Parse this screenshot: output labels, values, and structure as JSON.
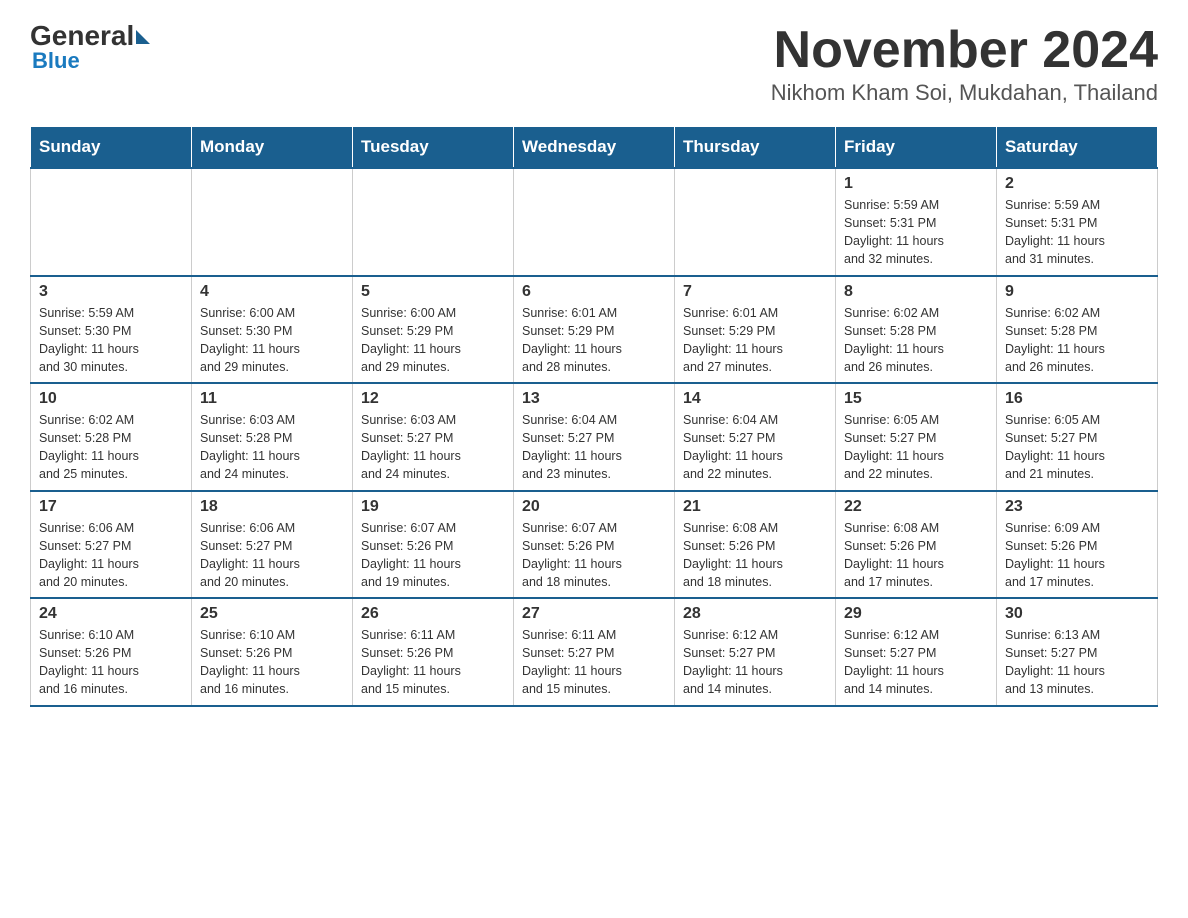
{
  "header": {
    "logo": {
      "general": "General",
      "blue": "Blue"
    },
    "title": "November 2024",
    "location": "Nikhom Kham Soi, Mukdahan, Thailand"
  },
  "calendar": {
    "days_of_week": [
      "Sunday",
      "Monday",
      "Tuesday",
      "Wednesday",
      "Thursday",
      "Friday",
      "Saturday"
    ],
    "weeks": [
      [
        {
          "day": "",
          "info": ""
        },
        {
          "day": "",
          "info": ""
        },
        {
          "day": "",
          "info": ""
        },
        {
          "day": "",
          "info": ""
        },
        {
          "day": "",
          "info": ""
        },
        {
          "day": "1",
          "info": "Sunrise: 5:59 AM\nSunset: 5:31 PM\nDaylight: 11 hours\nand 32 minutes."
        },
        {
          "day": "2",
          "info": "Sunrise: 5:59 AM\nSunset: 5:31 PM\nDaylight: 11 hours\nand 31 minutes."
        }
      ],
      [
        {
          "day": "3",
          "info": "Sunrise: 5:59 AM\nSunset: 5:30 PM\nDaylight: 11 hours\nand 30 minutes."
        },
        {
          "day": "4",
          "info": "Sunrise: 6:00 AM\nSunset: 5:30 PM\nDaylight: 11 hours\nand 29 minutes."
        },
        {
          "day": "5",
          "info": "Sunrise: 6:00 AM\nSunset: 5:29 PM\nDaylight: 11 hours\nand 29 minutes."
        },
        {
          "day": "6",
          "info": "Sunrise: 6:01 AM\nSunset: 5:29 PM\nDaylight: 11 hours\nand 28 minutes."
        },
        {
          "day": "7",
          "info": "Sunrise: 6:01 AM\nSunset: 5:29 PM\nDaylight: 11 hours\nand 27 minutes."
        },
        {
          "day": "8",
          "info": "Sunrise: 6:02 AM\nSunset: 5:28 PM\nDaylight: 11 hours\nand 26 minutes."
        },
        {
          "day": "9",
          "info": "Sunrise: 6:02 AM\nSunset: 5:28 PM\nDaylight: 11 hours\nand 26 minutes."
        }
      ],
      [
        {
          "day": "10",
          "info": "Sunrise: 6:02 AM\nSunset: 5:28 PM\nDaylight: 11 hours\nand 25 minutes."
        },
        {
          "day": "11",
          "info": "Sunrise: 6:03 AM\nSunset: 5:28 PM\nDaylight: 11 hours\nand 24 minutes."
        },
        {
          "day": "12",
          "info": "Sunrise: 6:03 AM\nSunset: 5:27 PM\nDaylight: 11 hours\nand 24 minutes."
        },
        {
          "day": "13",
          "info": "Sunrise: 6:04 AM\nSunset: 5:27 PM\nDaylight: 11 hours\nand 23 minutes."
        },
        {
          "day": "14",
          "info": "Sunrise: 6:04 AM\nSunset: 5:27 PM\nDaylight: 11 hours\nand 22 minutes."
        },
        {
          "day": "15",
          "info": "Sunrise: 6:05 AM\nSunset: 5:27 PM\nDaylight: 11 hours\nand 22 minutes."
        },
        {
          "day": "16",
          "info": "Sunrise: 6:05 AM\nSunset: 5:27 PM\nDaylight: 11 hours\nand 21 minutes."
        }
      ],
      [
        {
          "day": "17",
          "info": "Sunrise: 6:06 AM\nSunset: 5:27 PM\nDaylight: 11 hours\nand 20 minutes."
        },
        {
          "day": "18",
          "info": "Sunrise: 6:06 AM\nSunset: 5:27 PM\nDaylight: 11 hours\nand 20 minutes."
        },
        {
          "day": "19",
          "info": "Sunrise: 6:07 AM\nSunset: 5:26 PM\nDaylight: 11 hours\nand 19 minutes."
        },
        {
          "day": "20",
          "info": "Sunrise: 6:07 AM\nSunset: 5:26 PM\nDaylight: 11 hours\nand 18 minutes."
        },
        {
          "day": "21",
          "info": "Sunrise: 6:08 AM\nSunset: 5:26 PM\nDaylight: 11 hours\nand 18 minutes."
        },
        {
          "day": "22",
          "info": "Sunrise: 6:08 AM\nSunset: 5:26 PM\nDaylight: 11 hours\nand 17 minutes."
        },
        {
          "day": "23",
          "info": "Sunrise: 6:09 AM\nSunset: 5:26 PM\nDaylight: 11 hours\nand 17 minutes."
        }
      ],
      [
        {
          "day": "24",
          "info": "Sunrise: 6:10 AM\nSunset: 5:26 PM\nDaylight: 11 hours\nand 16 minutes."
        },
        {
          "day": "25",
          "info": "Sunrise: 6:10 AM\nSunset: 5:26 PM\nDaylight: 11 hours\nand 16 minutes."
        },
        {
          "day": "26",
          "info": "Sunrise: 6:11 AM\nSunset: 5:26 PM\nDaylight: 11 hours\nand 15 minutes."
        },
        {
          "day": "27",
          "info": "Sunrise: 6:11 AM\nSunset: 5:27 PM\nDaylight: 11 hours\nand 15 minutes."
        },
        {
          "day": "28",
          "info": "Sunrise: 6:12 AM\nSunset: 5:27 PM\nDaylight: 11 hours\nand 14 minutes."
        },
        {
          "day": "29",
          "info": "Sunrise: 6:12 AM\nSunset: 5:27 PM\nDaylight: 11 hours\nand 14 minutes."
        },
        {
          "day": "30",
          "info": "Sunrise: 6:13 AM\nSunset: 5:27 PM\nDaylight: 11 hours\nand 13 minutes."
        }
      ]
    ]
  }
}
